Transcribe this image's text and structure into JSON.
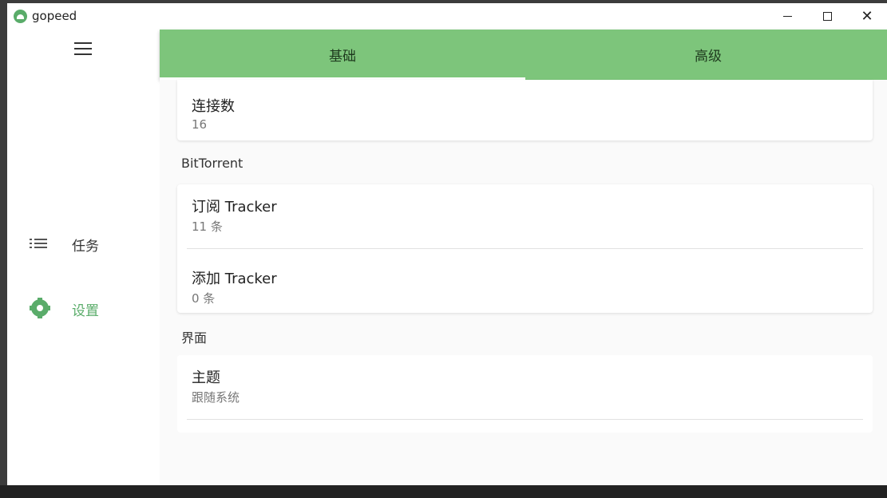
{
  "window": {
    "title": "gopeed",
    "controls": {
      "minimize": "minimize-icon",
      "maximize": "maximize-icon",
      "close": "✕"
    }
  },
  "sidebar": {
    "menu_icon": "hamburger-icon",
    "items": [
      {
        "label": "任务",
        "icon": "list-icon",
        "active": false
      },
      {
        "label": "设置",
        "icon": "gear-icon",
        "active": true
      }
    ]
  },
  "tabs": [
    {
      "label": "基础",
      "active": true
    },
    {
      "label": "高级",
      "active": false
    }
  ],
  "settings": {
    "connections": {
      "title": "连接数",
      "value": "16"
    },
    "bittorrent": {
      "section_label": "BitTorrent",
      "subscribe_tracker": {
        "title": "订阅 Tracker",
        "value": "11 条"
      },
      "add_tracker": {
        "title": "添加 Tracker",
        "value": "0 条"
      }
    },
    "interface": {
      "section_label": "界面",
      "theme": {
        "title": "主题",
        "value": "跟随系统"
      }
    }
  },
  "colors": {
    "accent": "#5aac6a",
    "tab_bar": "#7dc57b",
    "background": "#fafafa"
  }
}
